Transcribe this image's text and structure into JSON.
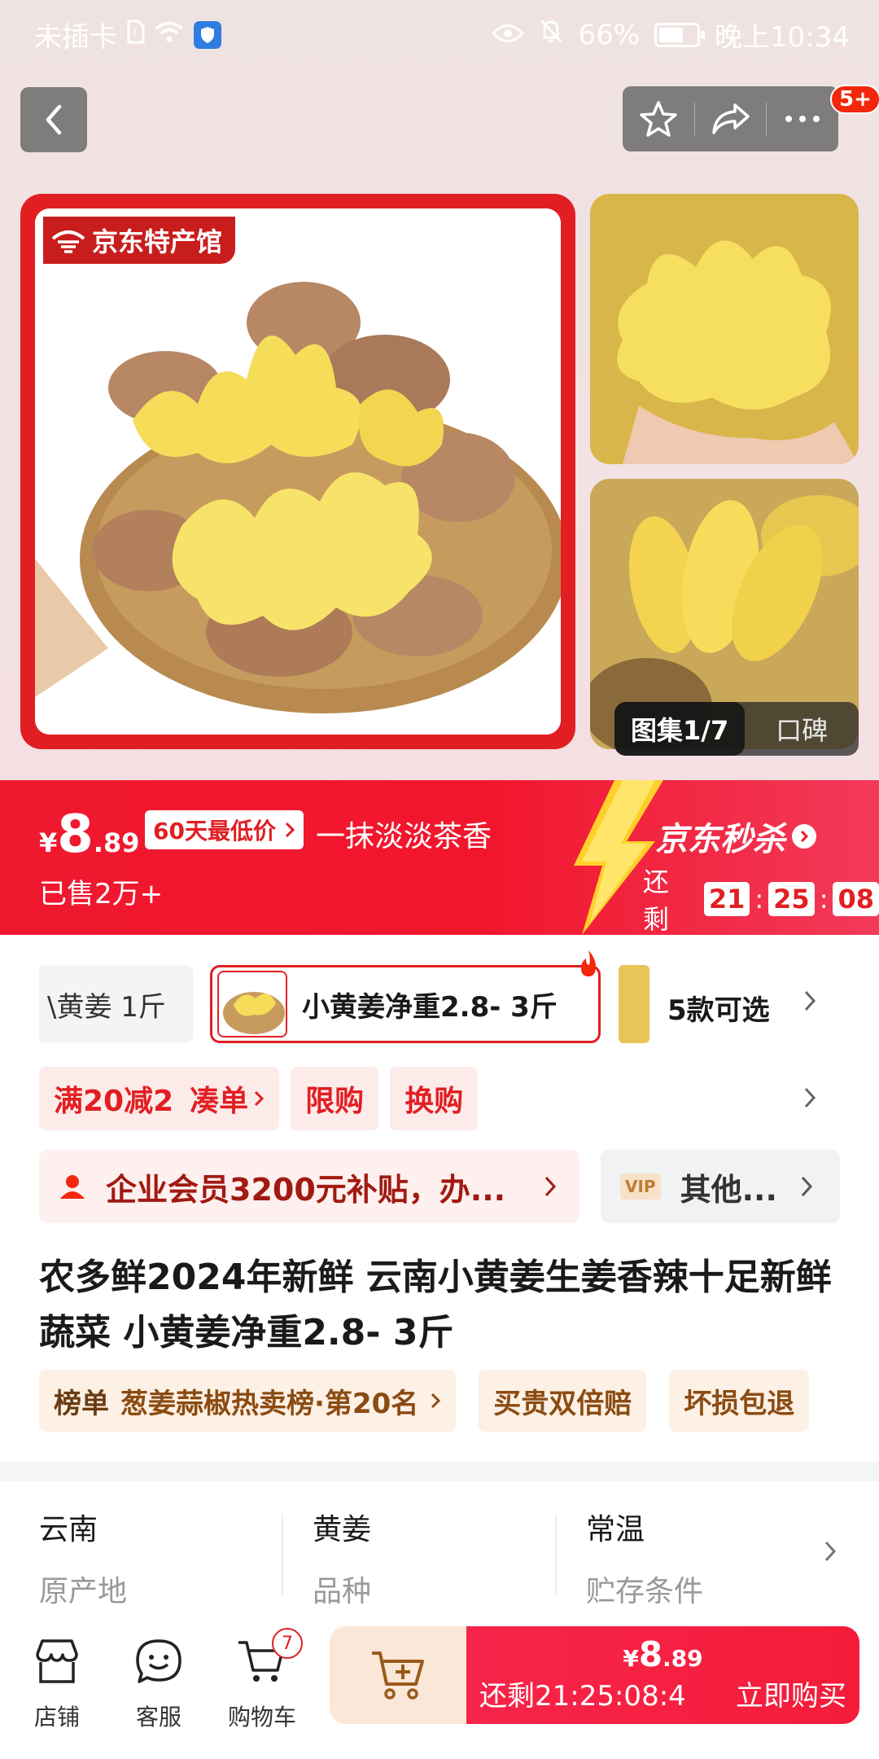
{
  "status_bar": {
    "carrier": "未插卡",
    "battery": "66%",
    "battery_level": 0.66,
    "time": "晚上10:34"
  },
  "header": {
    "notification_badge": "5+"
  },
  "gallery": {
    "logo_text": "京东特产馆",
    "counter_label": "图集1/7",
    "review_tab": "口碑"
  },
  "price_banner": {
    "currency": "¥",
    "price_int": "8",
    "price_dec": ".89",
    "low_price_tag": "60天最低价",
    "slogan": "一抹淡淡茶香",
    "sold": "已售2万+",
    "seckill_title": "京东秒杀",
    "countdown_label": "还剩",
    "hours": "21",
    "minutes": "25",
    "seconds": "08"
  },
  "sku": {
    "prev_label": "\\黄姜 1斤",
    "active_label": "小黄姜净重2.8- 3斤",
    "options_count": "5款可选"
  },
  "promos": {
    "coupon": "满20减2",
    "coupon_action": "凑单",
    "limit": "限购",
    "exchange": "换购"
  },
  "member": {
    "text": "企业会员3200元补贴，办...",
    "vip_label": "VIP",
    "other": "其他..."
  },
  "product": {
    "title": "农多鲜2024年新鲜 云南小黄姜生姜香辣十足新鲜蔬菜 小黄姜净重2.8- 3斤"
  },
  "ranking": {
    "label": "榜单",
    "text": "葱姜蒜椒热卖榜·第20名",
    "guarantee1": "买贵双倍赔",
    "guarantee2": "坏损包退"
  },
  "attributes": [
    {
      "value": "云南",
      "key": "原产地"
    },
    {
      "value": "黄姜",
      "key": "品种"
    },
    {
      "value": "常温",
      "key": "贮存条件"
    }
  ],
  "bottom_bar": {
    "store": "店铺",
    "service": "客服",
    "cart": "购物车",
    "cart_count": "7",
    "buy_currency": "¥",
    "buy_price_int": "8",
    "buy_price_dec": ".89",
    "buy_countdown": "还剩21:25:08:4",
    "buy_label": "立即购买"
  },
  "colors": {
    "jd_red": "#e11f23",
    "banner_red": "#f0182f",
    "member_text": "#a11a12",
    "rank_text": "#8a4b12"
  }
}
